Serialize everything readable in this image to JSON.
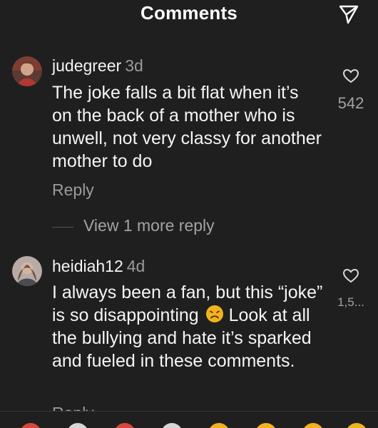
{
  "header": {
    "title": "Comments"
  },
  "comments": [
    {
      "username": "judegreer",
      "time": "3d",
      "text": "The joke falls a bit flat when it’s on the back of a mother who is unwell, not very classy for another mother to do",
      "reply_label": "Reply",
      "likes": "542",
      "more_replies": "View 1 more reply"
    },
    {
      "username": "heidiah12",
      "time": "4d",
      "text_before_emoji": "I always been a fan, but this “joke” is so disappointing ",
      "text_after_emoji": "Look at all the bullying and hate it’s sparked and fueled in these comments.",
      "reply_label": "Reply",
      "likes": "1,5..."
    }
  ],
  "colors": {
    "background": "#1f1f1f",
    "primary_text": "#f5f5f5",
    "secondary_text": "#9a9a9a"
  },
  "icons": [
    "send-icon",
    "heart-icon",
    "disappointed-face-emoji"
  ]
}
